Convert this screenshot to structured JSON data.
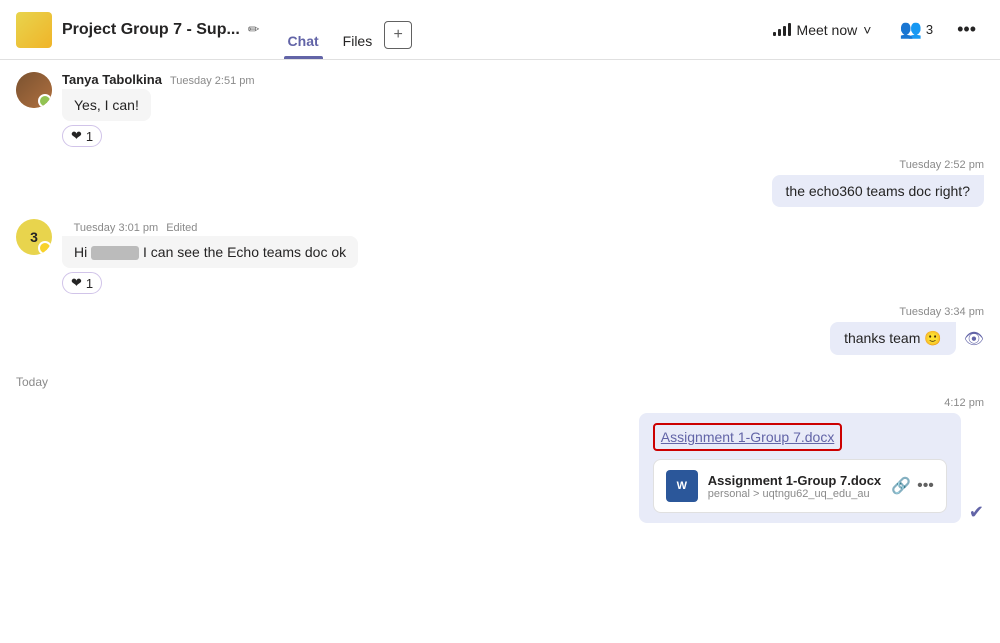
{
  "header": {
    "group_name": "Project Group 7 - Sup...",
    "edit_icon": "✏",
    "tabs": [
      {
        "id": "chat",
        "label": "Chat",
        "active": true
      },
      {
        "id": "files",
        "label": "Files",
        "active": false
      }
    ],
    "add_tab_icon": "+",
    "meet_now_label": "Meet now",
    "chevron_icon": "⌄",
    "participants_count": "3",
    "more_icon": "···"
  },
  "messages": [
    {
      "id": "msg1",
      "type": "left",
      "sender": "Tanya Tabolkina",
      "time": "Tuesday 2:51 pm",
      "edited": false,
      "text": "Yes, I can!",
      "reaction": "❤",
      "reaction_count": "1",
      "avatar_type": "photo"
    },
    {
      "id": "msg2",
      "type": "right",
      "time": "Tuesday 2:52 pm",
      "text": "the echo360 teams doc right?"
    },
    {
      "id": "msg3",
      "type": "left",
      "sender": "",
      "time": "Tuesday 3:01 pm",
      "edited": true,
      "text_prefix": "Hi",
      "text_redacted": "███",
      "text_suffix": "I can see the Echo teams doc ok",
      "reaction": "❤",
      "reaction_count": "1",
      "avatar_type": "number",
      "avatar_label": "3"
    },
    {
      "id": "msg4",
      "type": "right",
      "time": "Tuesday 3:34 pm",
      "text": "thanks team 🙂",
      "seen": true
    },
    {
      "id": "divider",
      "type": "divider",
      "label": "Today"
    },
    {
      "id": "msg5",
      "type": "right",
      "time": "4:12 pm",
      "file_link": "Assignment 1-Group 7.docx",
      "file_card": {
        "name": "Assignment 1-Group 7.docx",
        "path": "personal > uqtngu62_uq_edu_au"
      }
    }
  ],
  "icons": {
    "edit": "✏",
    "signal": "signal",
    "chevron": "˅",
    "more": "•••",
    "link": "🔗",
    "check_circle": "✔"
  }
}
